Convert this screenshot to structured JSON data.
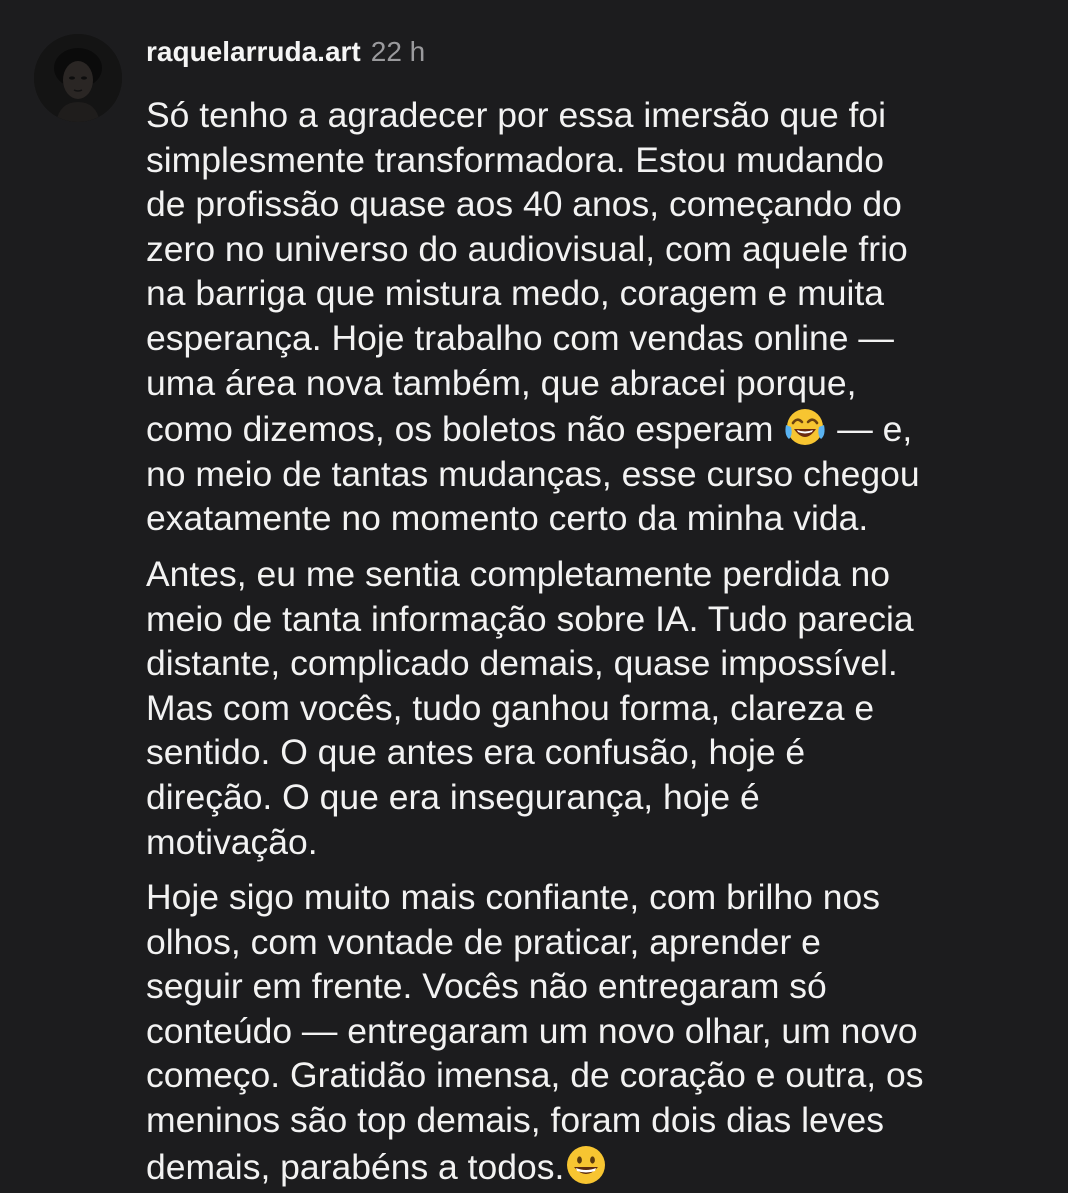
{
  "comment": {
    "username": "raquelarruda.art",
    "timestamp": "22 h",
    "avatar_icon": "profile-photo-avatar",
    "paragraphs": [
      {
        "lines": [
          "Só tenho a agradecer por essa imersão que foi",
          "simplesmente transformadora. Estou mudando",
          "de profissão quase aos 40 anos, começando do",
          "zero no universo do audiovisual, com aquele frio",
          "na barriga que mistura medo, coragem e muita",
          "esperança. Hoje trabalho com vendas online —",
          "uma área nova também, que abracei porque,"
        ],
        "emoji_line_before": "como dizemos, os boletos não esperam",
        "emoji_line_after": " — e,",
        "emoji_icon": "tears-of-joy-emoji",
        "lines_after": [
          "no meio de tantas mudanças, esse curso chegou",
          "exatamente no momento certo da minha vida."
        ]
      },
      {
        "lines": [
          "Antes, eu me sentia completamente perdida no",
          "meio de tanta informação sobre IA. Tudo parecia",
          "distante, complicado demais, quase impossível.",
          "Mas com vocês, tudo ganhou forma, clareza e",
          "sentido. O que antes era confusão, hoje é",
          "direção. O que era insegurança, hoje é",
          "motivação."
        ]
      },
      {
        "lines": [
          "Hoje sigo muito mais confiante, com brilho nos",
          "olhos, com vontade de praticar, aprender e",
          "seguir em frente. Vocês não entregaram só",
          "conteúdo — entregaram um novo olhar, um novo",
          "começo. Gratidão imensa, de coração e outra, os",
          "meninos são top demais, foram dois dias leves"
        ],
        "emoji_line_before": "demais, parabéns a todos.",
        "emoji_icon": "grinning-face-emoji"
      }
    ]
  },
  "colors": {
    "background": "#1c1c1e",
    "text": "#f2f2f2",
    "timestamp": "#9a9a9d",
    "emoji_yellow": "#f7c531"
  }
}
